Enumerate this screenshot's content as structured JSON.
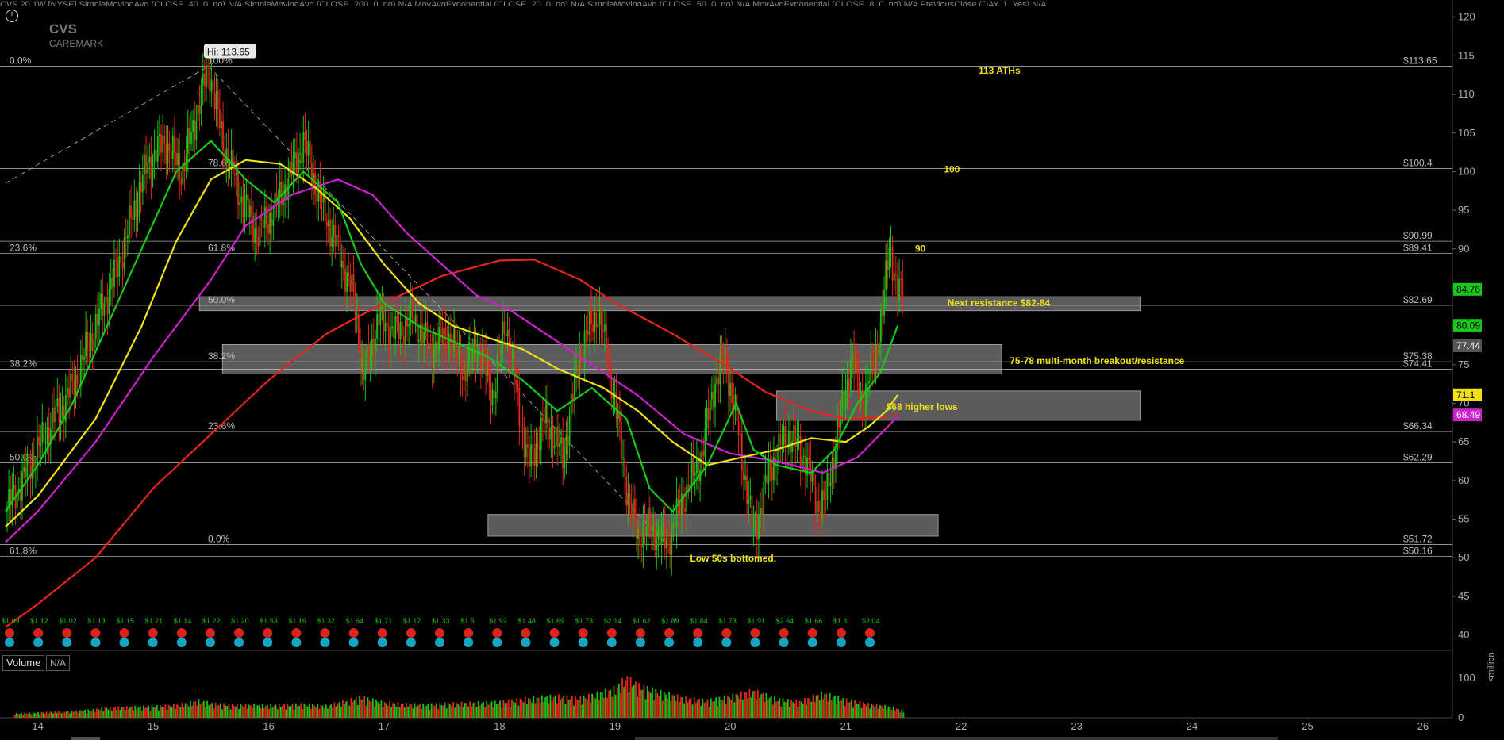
{
  "header": {
    "title": "CVS 20 1W [NYSE]",
    "studies": "SimpleMovingAvg (CLOSE, 40, 0, no)  N/A  SimpleMovingAvg (CLOSE, 200, 0, no)  N/A  MovAvgExponential (CLOSE, 20, 0, no)  N/A  SimpleMovingAvg (CLOSE, 50, 0, no)  N/A  MovAvgExponential (CLOSE, 8, 0, no)  N/A  PreviousClose (DAY, 1, Yes)  N/A"
  },
  "logo": {
    "line1": "CVS",
    "line2": "CAREMARK"
  },
  "icons": {
    "info": "info-icon"
  },
  "colors": {
    "background": "#000000",
    "up_candle": "#16c416",
    "down_candle": "#e8241c",
    "sma200": "#e8241c",
    "sma40": "#cc22cc",
    "sma50": "#f0e018",
    "ema20": "#18c818",
    "annotation": "#f0e018",
    "zone": "#808080"
  },
  "chart_data": {
    "type": "line",
    "title": "",
    "xlabel": "",
    "ylabel": "",
    "x_ticks": [
      "14",
      "15",
      "16",
      "17",
      "18",
      "19",
      "20",
      "21",
      "22",
      "23",
      "24",
      "25",
      "26"
    ],
    "x_range": [
      13.7,
      26.2
    ],
    "ylim": [
      38,
      121
    ],
    "y_ticks": [
      40,
      45,
      50,
      55,
      60,
      65,
      70,
      75,
      80,
      85,
      90,
      95,
      100,
      105,
      110,
      115,
      120
    ],
    "price_path": [
      [
        13.72,
        56
      ],
      [
        13.9,
        61
      ],
      [
        14.1,
        67
      ],
      [
        14.3,
        72
      ],
      [
        14.5,
        80
      ],
      [
        14.7,
        88
      ],
      [
        14.85,
        96
      ],
      [
        14.95,
        101
      ],
      [
        15.1,
        104
      ],
      [
        15.25,
        100
      ],
      [
        15.35,
        106
      ],
      [
        15.48,
        113.65
      ],
      [
        15.6,
        104
      ],
      [
        15.75,
        97
      ],
      [
        15.9,
        92
      ],
      [
        16.05,
        95
      ],
      [
        16.2,
        100
      ],
      [
        16.3,
        104
      ],
      [
        16.45,
        96
      ],
      [
        16.6,
        90
      ],
      [
        16.75,
        83
      ],
      [
        16.82,
        73
      ],
      [
        16.95,
        81
      ],
      [
        17.1,
        79
      ],
      [
        17.25,
        81
      ],
      [
        17.4,
        77
      ],
      [
        17.55,
        79
      ],
      [
        17.7,
        74
      ],
      [
        17.8,
        78
      ],
      [
        17.95,
        71
      ],
      [
        18.05,
        81
      ],
      [
        18.15,
        71
      ],
      [
        18.25,
        62
      ],
      [
        18.4,
        68
      ],
      [
        18.55,
        63
      ],
      [
        18.7,
        77
      ],
      [
        18.85,
        82
      ],
      [
        18.95,
        75
      ],
      [
        19.05,
        65
      ],
      [
        19.12,
        57
      ],
      [
        19.2,
        53
      ],
      [
        19.3,
        54
      ],
      [
        19.45,
        52
      ],
      [
        19.6,
        58
      ],
      [
        19.75,
        63
      ],
      [
        19.85,
        72
      ],
      [
        19.95,
        76
      ],
      [
        20.05,
        68
      ],
      [
        20.15,
        58
      ],
      [
        20.2,
        53
      ],
      [
        20.35,
        62
      ],
      [
        20.5,
        66
      ],
      [
        20.65,
        63
      ],
      [
        20.75,
        57
      ],
      [
        20.82,
        57
      ],
      [
        20.95,
        68
      ],
      [
        21.05,
        76
      ],
      [
        21.15,
        70
      ],
      [
        21.25,
        76
      ],
      [
        21.32,
        82
      ],
      [
        21.38,
        90.99
      ],
      [
        21.45,
        84
      ],
      [
        21.5,
        84.76
      ]
    ],
    "volume": {
      "ylim": [
        0,
        120
      ],
      "y_ticks": [
        0,
        100
      ],
      "bars": [
        [
          13.8,
          12
        ],
        [
          14,
          14
        ],
        [
          14.2,
          18
        ],
        [
          14.4,
          20
        ],
        [
          14.6,
          28
        ],
        [
          14.8,
          30
        ],
        [
          15,
          32
        ],
        [
          15.2,
          35
        ],
        [
          15.4,
          48
        ],
        [
          15.5,
          40
        ],
        [
          15.7,
          36
        ],
        [
          16,
          34
        ],
        [
          16.3,
          38
        ],
        [
          16.5,
          33
        ],
        [
          16.8,
          58
        ],
        [
          17,
          42
        ],
        [
          17.3,
          36
        ],
        [
          17.6,
          40
        ],
        [
          18,
          44
        ],
        [
          18.2,
          52
        ],
        [
          18.5,
          60
        ],
        [
          18.7,
          55
        ],
        [
          19,
          80
        ],
        [
          19.1,
          112
        ],
        [
          19.2,
          90
        ],
        [
          19.4,
          70
        ],
        [
          19.6,
          55
        ],
        [
          19.8,
          48
        ],
        [
          20,
          60
        ],
        [
          20.2,
          75
        ],
        [
          20.4,
          52
        ],
        [
          20.6,
          45
        ],
        [
          20.8,
          68
        ],
        [
          21,
          50
        ],
        [
          21.2,
          38
        ],
        [
          21.4,
          30
        ],
        [
          21.5,
          18
        ]
      ]
    },
    "series": [
      {
        "name": "SimpleMovingAvg (CLOSE, 200, 0, no)",
        "color": "#e8241c",
        "points": [
          [
            13.72,
            41
          ],
          [
            14,
            44
          ],
          [
            14.5,
            50
          ],
          [
            15,
            59
          ],
          [
            15.5,
            66
          ],
          [
            16,
            73
          ],
          [
            16.5,
            79
          ],
          [
            17,
            83
          ],
          [
            17.5,
            86.5
          ],
          [
            18,
            88.5
          ],
          [
            18.3,
            88.6
          ],
          [
            18.7,
            86
          ],
          [
            19,
            83
          ],
          [
            19.5,
            79
          ],
          [
            20,
            74.5
          ],
          [
            20.3,
            71.5
          ],
          [
            20.7,
            69
          ],
          [
            21,
            68
          ],
          [
            21.3,
            68.2
          ],
          [
            21.45,
            68.49
          ]
        ]
      },
      {
        "name": "SimpleMovingAvg (CLOSE, 40, 0, no)",
        "color": "#cc22cc",
        "points": [
          [
            13.72,
            52
          ],
          [
            14,
            56
          ],
          [
            14.5,
            65
          ],
          [
            15,
            76
          ],
          [
            15.5,
            86
          ],
          [
            15.8,
            93
          ],
          [
            16.2,
            97
          ],
          [
            16.6,
            99
          ],
          [
            16.9,
            97
          ],
          [
            17.2,
            92
          ],
          [
            17.5,
            88
          ],
          [
            17.8,
            84
          ],
          [
            18.1,
            82
          ],
          [
            18.5,
            78
          ],
          [
            18.9,
            74
          ],
          [
            19.2,
            71
          ],
          [
            19.6,
            66
          ],
          [
            20,
            63.5
          ],
          [
            20.4,
            62.5
          ],
          [
            20.8,
            61
          ],
          [
            21.1,
            63
          ],
          [
            21.3,
            66
          ],
          [
            21.45,
            68.3
          ]
        ]
      },
      {
        "name": "SimpleMovingAvg (CLOSE, 50, 0, no)",
        "color": "#f0e018",
        "points": [
          [
            13.72,
            54
          ],
          [
            14,
            58
          ],
          [
            14.5,
            68
          ],
          [
            14.9,
            80
          ],
          [
            15.2,
            91
          ],
          [
            15.5,
            99
          ],
          [
            15.8,
            101.5
          ],
          [
            16.1,
            101
          ],
          [
            16.4,
            98
          ],
          [
            16.7,
            94
          ],
          [
            17,
            88
          ],
          [
            17.3,
            83
          ],
          [
            17.6,
            80
          ],
          [
            17.9,
            78.5
          ],
          [
            18.2,
            77
          ],
          [
            18.5,
            74.5
          ],
          [
            18.9,
            72
          ],
          [
            19.2,
            69
          ],
          [
            19.5,
            65
          ],
          [
            19.8,
            62
          ],
          [
            20.1,
            63
          ],
          [
            20.4,
            64
          ],
          [
            20.7,
            65.5
          ],
          [
            21,
            65
          ],
          [
            21.2,
            67
          ],
          [
            21.35,
            69
          ],
          [
            21.45,
            71.1
          ]
        ]
      },
      {
        "name": "MovAvgExponential (CLOSE, 20, 0, no)",
        "color": "#18c818",
        "points": [
          [
            13.72,
            56
          ],
          [
            14,
            62
          ],
          [
            14.3,
            70
          ],
          [
            14.6,
            80
          ],
          [
            14.9,
            90
          ],
          [
            15.2,
            100
          ],
          [
            15.5,
            104
          ],
          [
            15.8,
            99
          ],
          [
            16.05,
            96
          ],
          [
            16.3,
            100
          ],
          [
            16.6,
            96
          ],
          [
            16.8,
            88
          ],
          [
            17,
            83
          ],
          [
            17.3,
            80
          ],
          [
            17.6,
            78
          ],
          [
            17.9,
            76
          ],
          [
            18.2,
            73
          ],
          [
            18.5,
            69
          ],
          [
            18.8,
            72
          ],
          [
            19.1,
            68
          ],
          [
            19.3,
            59
          ],
          [
            19.5,
            56
          ],
          [
            19.8,
            62
          ],
          [
            20.05,
            70
          ],
          [
            20.2,
            64
          ],
          [
            20.4,
            62
          ],
          [
            20.7,
            61
          ],
          [
            20.9,
            64
          ],
          [
            21.1,
            70
          ],
          [
            21.3,
            74
          ],
          [
            21.45,
            80.09
          ]
        ]
      }
    ],
    "price_labels": [
      {
        "value": 84.76,
        "text": "84.76",
        "bg": "#18c818",
        "fg": "#000000"
      },
      {
        "value": 80.09,
        "text": "80.09",
        "bg": "#18c818",
        "fg": "#000000"
      },
      {
        "value": 77.44,
        "text": "77.44",
        "bg": "#555555",
        "fg": "#ffffff"
      },
      {
        "value": 71.1,
        "text": "71.1",
        "bg": "#f0e018",
        "fg": "#000000"
      },
      {
        "value": 68.49,
        "text": "68.49",
        "bg": "#cc22cc",
        "fg": "#ffffff"
      }
    ],
    "levels": [
      {
        "value": 113.65,
        "label": "$113.65"
      },
      {
        "value": 100.4,
        "label": "$100.4"
      },
      {
        "value": 90.99,
        "label": "$90.99"
      },
      {
        "value": 89.41,
        "label": "$89.41"
      },
      {
        "value": 82.69,
        "label": "$82.69"
      },
      {
        "value": 75.38,
        "label": "$75.38"
      },
      {
        "value": 74.41,
        "label": "$74.41"
      },
      {
        "value": 66.34,
        "label": "$66.34"
      },
      {
        "value": 62.29,
        "label": "$62.29"
      },
      {
        "value": 51.72,
        "label": "$51.72"
      },
      {
        "value": 50.16,
        "label": "$50.16"
      }
    ],
    "fib_labels_left": [
      {
        "value": 113.65,
        "text": "0.0%"
      },
      {
        "value": 89.41,
        "text": "23.6%"
      },
      {
        "value": 74.41,
        "text": "38.2%"
      },
      {
        "value": 62.29,
        "text": "50.0%"
      },
      {
        "value": 50.16,
        "text": "61.8%"
      }
    ],
    "fib_labels_mid": [
      {
        "value": 113.65,
        "text": "100%"
      },
      {
        "value": 100.4,
        "text": "78.6%"
      },
      {
        "value": 89.41,
        "text": "61.8%"
      },
      {
        "value": 82.69,
        "text": "50.0%"
      },
      {
        "value": 75.38,
        "text": "38.2%"
      },
      {
        "value": 66.34,
        "text": "23.6%"
      },
      {
        "value": 51.72,
        "text": "0.0%"
      }
    ],
    "zones": [
      {
        "x0": 15.4,
        "x1": 23.55,
        "y0": 82.0,
        "y1": 83.8
      },
      {
        "x0": 15.6,
        "x1": 22.35,
        "y0": 73.8,
        "y1": 77.6
      },
      {
        "x0": 20.4,
        "x1": 23.55,
        "y0": 67.8,
        "y1": 71.6
      },
      {
        "x0": 17.9,
        "x1": 21.8,
        "y0": 52.8,
        "y1": 55.6
      }
    ],
    "annotations": [
      {
        "x": 22.15,
        "y": 112.7,
        "text": "113 ATHs"
      },
      {
        "x": 21.85,
        "y": 99.9,
        "text": "100"
      },
      {
        "x": 21.6,
        "y": 89.6,
        "text": "90"
      },
      {
        "x": 21.88,
        "y": 82.6,
        "text": "Next resistance $82-84"
      },
      {
        "x": 22.42,
        "y": 75.1,
        "text": "75-78 multi-month breakout/resistance"
      },
      {
        "x": 21.35,
        "y": 69.1,
        "text": "$68 higher lows"
      },
      {
        "x": 19.65,
        "y": 49.5,
        "text": "Low 50s bottomed."
      }
    ],
    "hi_label": {
      "x": 15.48,
      "y": 113.65,
      "text": "Hi: 113.65"
    },
    "dividends": [
      "$1.09",
      "$1.12",
      "$1.02",
      "$1.13",
      "$1.15",
      "$1.21",
      "$1.14",
      "$1.22",
      "$1.20",
      "$1.53",
      "$1.16",
      "$1.32",
      "$1.64",
      "$1.71",
      "$1.17",
      "$1.33",
      "$1.5",
      "$1.92",
      "$1.48",
      "$1.69",
      "$1.73",
      "$2.14",
      "$1.62",
      "$1.89",
      "$1.84",
      "$1.73",
      "$1.91",
      "$2.64",
      "$1.66",
      "$1.3",
      "$2.04"
    ]
  }
}
